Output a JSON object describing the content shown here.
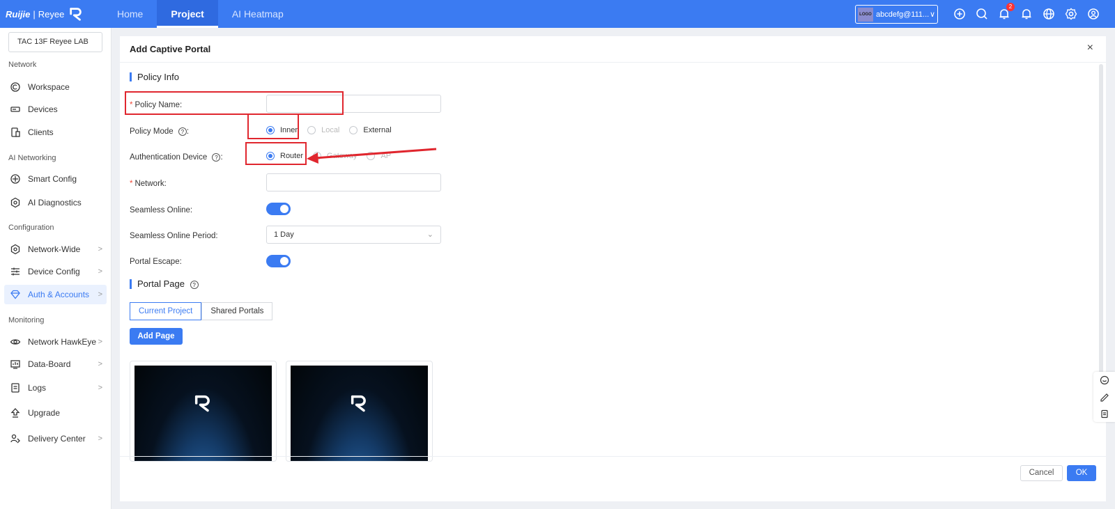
{
  "topbar": {
    "brand": "Ruijie",
    "brand_sep": "|",
    "brand_sub": "Reyee",
    "nav": [
      {
        "label": "Home",
        "active": false
      },
      {
        "label": "Project",
        "active": true
      },
      {
        "label": "AI Heatmap",
        "active": false
      }
    ],
    "account": {
      "logo_text": "LOGO",
      "name": "abcdefg@111....",
      "chevron": "∨"
    },
    "notification_count": "2",
    "icons": [
      "add-circle-icon",
      "search-icon",
      "notification-bell-icon",
      "alert-bell-icon",
      "globe-icon",
      "gear-icon",
      "user-icon"
    ]
  },
  "sidebar": {
    "project": "TAC 13F Reyee LAB",
    "sections": {
      "network": "Network",
      "ai_networking": "AI Networking",
      "configuration": "Configuration",
      "monitoring": "Monitoring"
    },
    "items": [
      {
        "label": "Workspace",
        "icon": "workspace-icon"
      },
      {
        "label": "Devices",
        "icon": "devices-icon"
      },
      {
        "label": "Clients",
        "icon": "clients-icon"
      },
      {
        "label": "Smart Config",
        "icon": "smart-config-icon"
      },
      {
        "label": "AI Diagnostics",
        "icon": "ai-diagnostics-icon"
      },
      {
        "label": "Network-Wide",
        "icon": "network-wide-icon"
      },
      {
        "label": "Device Config",
        "icon": "device-config-icon"
      },
      {
        "label": "Auth & Accounts",
        "icon": "auth-accounts-icon",
        "active": true
      },
      {
        "label": "Network HawkEye",
        "icon": "hawkeye-icon"
      },
      {
        "label": "Data-Board",
        "icon": "data-board-icon"
      },
      {
        "label": "Logs",
        "icon": "logs-icon"
      },
      {
        "label": "Upgrade",
        "icon": "upgrade-icon"
      },
      {
        "label": "Delivery Center",
        "icon": "delivery-center-icon"
      }
    ],
    "chevron": ">"
  },
  "dialog": {
    "title": "Add Captive Portal",
    "close": "×",
    "policy_info": "Policy Info",
    "fields": {
      "required_mark": "*",
      "policy_name": {
        "label": "Policy Name:",
        "value": "",
        "placeholder": ""
      },
      "policy_mode": {
        "label": "Policy Mode",
        "colon": ":",
        "options": [
          "Inner",
          "Local",
          "External"
        ],
        "selected": "Inner"
      },
      "auth_device": {
        "label": "Authentication Device",
        "colon": ":",
        "options": [
          "Router",
          "Gateway",
          "AP"
        ],
        "selected": "Router"
      },
      "network": {
        "label": "Network:",
        "value": ""
      },
      "seamless_online": {
        "label": "Seamless Online:",
        "on": true
      },
      "seamless_period": {
        "label": "Seamless Online Period:",
        "value": "1 Day"
      },
      "portal_escape": {
        "label": "Portal Escape:",
        "on": true
      }
    },
    "portal_page": "Portal Page",
    "help_mark": "?",
    "tabs": [
      "Current Project",
      "Shared Portals"
    ],
    "active_tab": "Current Project",
    "add_page": "Add Page",
    "footer": {
      "cancel": "Cancel",
      "ok": "OK"
    }
  },
  "side_tools": [
    "chat-icon",
    "feedback-icon",
    "clipboard-icon"
  ],
  "colors": {
    "accent": "#3b7bf2",
    "annotation": "#e0262e",
    "required": "#f04a3a"
  }
}
